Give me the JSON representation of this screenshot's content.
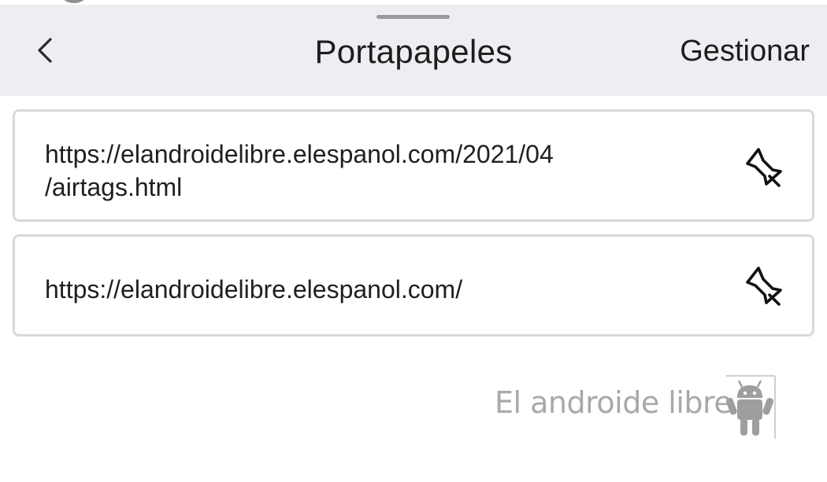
{
  "header": {
    "title": "Portapapeles",
    "manage_label": "Gestionar"
  },
  "clipboard_items": [
    {
      "text_line1": "https://elandroidelibre.elespanol.com/2021/04",
      "text_line2": "/airtags.html"
    },
    {
      "text_line1": "https://elandroidelibre.elespanol.com/"
    }
  ],
  "watermark": {
    "text": "El androide libre"
  },
  "icons": {
    "back": "chevron-left-icon",
    "pin": "pushpin-icon",
    "logo": "android-robot-icon"
  },
  "colors": {
    "header_bg": "#eceef1",
    "text": "#1d1d1d",
    "card_border": "#d9d9d9",
    "watermark": "#a9a9a9"
  }
}
